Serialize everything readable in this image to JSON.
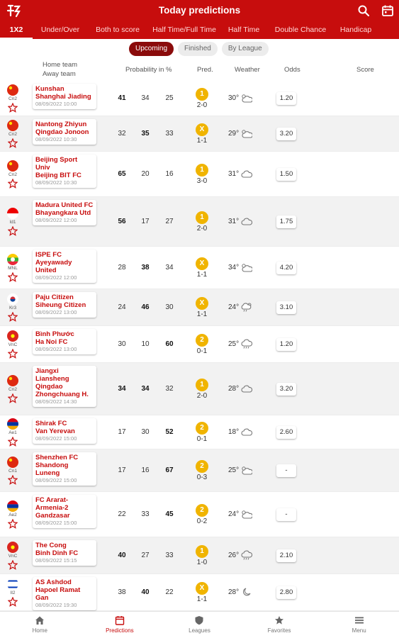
{
  "header": {
    "title": "Today predictions",
    "tabs": [
      "1X2",
      "Under/Over",
      "Both to score",
      "Half Time/Full Time",
      "Half Time",
      "Double Chance",
      "Handicap"
    ]
  },
  "filters": [
    "Upcoming",
    "Finished",
    "By League"
  ],
  "columns": {
    "home_team": "Home team",
    "away_team": "Away team",
    "probability": "Probability in %",
    "pred": "Pred.",
    "weather": "Weather",
    "odds": "Odds",
    "score": "Score"
  },
  "matches": [
    {
      "league": "Cn2",
      "home": "Kunshan",
      "away": "Shanghai Jiading",
      "date": "08/09/2022 10:00",
      "p1": "41",
      "px": "34",
      "p2": "25",
      "pred": "1",
      "pred_score": "2-0",
      "temp": "30°",
      "weather_icon": "cloud-sun-icon",
      "odds": "1.20"
    },
    {
      "league": "Cn2",
      "home": "Nantong Zhiyun",
      "away": "Qingdao Jonoon",
      "date": "08/09/2022 10:30",
      "p1": "32",
      "px": "35",
      "p2": "33",
      "pred": "X",
      "pred_score": "1-1",
      "temp": "29°",
      "weather_icon": "cloud-sun-icon",
      "odds": "3.20"
    },
    {
      "league": "Cn2",
      "home": "Beijing Sport Univ",
      "away": "Beijing BIT FC",
      "date": "08/09/2022 10:30",
      "p1": "65",
      "px": "20",
      "p2": "16",
      "pred": "1",
      "pred_score": "3-0",
      "temp": "31°",
      "weather_icon": "cloud-icon",
      "odds": "1.50"
    },
    {
      "league": "Id1",
      "home": "Madura United FC",
      "away": "Bhayangkara Utd",
      "date": "08/09/2022 12:00",
      "p1": "56",
      "px": "17",
      "p2": "27",
      "pred": "1",
      "pred_score": "2-0",
      "temp": "31°",
      "weather_icon": "cloud-icon",
      "odds": "1.75"
    },
    {
      "league": "MNL",
      "home": "ISPE FC",
      "away": "Ayeyawady United",
      "date": "08/09/2022 12:00",
      "p1": "28",
      "px": "38",
      "p2": "34",
      "pred": "X",
      "pred_score": "1-1",
      "temp": "34°",
      "weather_icon": "cloud-sun-icon",
      "odds": "4.20"
    },
    {
      "league": "Kr3",
      "home": "Paju Citizen",
      "away": "Siheung Citizen",
      "date": "08/09/2022 13:00",
      "p1": "24",
      "px": "46",
      "p2": "30",
      "pred": "X",
      "pred_score": "1-1",
      "temp": "24°",
      "weather_icon": "cloud-rain-sun-icon",
      "odds": "3.10"
    },
    {
      "league": "VnC",
      "home": "Bình Phước",
      "away": "Ha Noi FC",
      "date": "08/09/2022 13:00",
      "p1": "30",
      "px": "10",
      "p2": "60",
      "pred": "2",
      "pred_score": "0-1",
      "temp": "25°",
      "weather_icon": "cloud-rain-icon",
      "odds": "1.20"
    },
    {
      "league": "Cn2",
      "home": "Jiangxi Liansheng",
      "away": "Qingdao Zhongchuang H.",
      "date": "08/09/2022 14:30",
      "p1": "34",
      "px": "34",
      "p2": "32",
      "pred": "1",
      "pred_score": "2-0",
      "temp": "28°",
      "weather_icon": "cloud-icon",
      "odds": "3.20"
    },
    {
      "league": "Ae1",
      "home": "Shirak FC",
      "away": "Van Yerevan",
      "date": "08/09/2022 15:00",
      "p1": "17",
      "px": "30",
      "p2": "52",
      "pred": "2",
      "pred_score": "0-1",
      "temp": "18°",
      "weather_icon": "cloud-icon",
      "odds": "2.60"
    },
    {
      "league": "Cn1",
      "home": "Shenzhen FC",
      "away": "Shandong Luneng",
      "date": "08/09/2022 15:00",
      "p1": "17",
      "px": "16",
      "p2": "67",
      "pred": "2",
      "pred_score": "0-3",
      "temp": "25°",
      "weather_icon": "cloud-sun-icon",
      "odds": "-"
    },
    {
      "league": "Ae2",
      "home": "FC Ararat-Armenia-2",
      "away": "Gandzasar",
      "date": "08/09/2022 15:00",
      "p1": "22",
      "px": "33",
      "p2": "45",
      "pred": "2",
      "pred_score": "0-2",
      "temp": "24°",
      "weather_icon": "cloud-sun-icon",
      "odds": "-"
    },
    {
      "league": "VnC",
      "home": "The Cong",
      "away": "Binh Dinh FC",
      "date": "08/09/2022 15:15",
      "p1": "40",
      "px": "27",
      "p2": "33",
      "pred": "1",
      "pred_score": "1-0",
      "temp": "26°",
      "weather_icon": "cloud-rain-icon",
      "odds": "2.10"
    },
    {
      "league": "Il2",
      "home": "AS Ashdod",
      "away": "Hapoel Ramat Gan",
      "date": "08/09/2022 19:30",
      "p1": "38",
      "px": "40",
      "p2": "22",
      "pred": "X",
      "pred_score": "1-1",
      "temp": "28°",
      "weather_icon": "moon-cloud-icon",
      "odds": "2.80"
    }
  ],
  "nav": [
    "Home",
    "Predictions",
    "Leagues",
    "Favorites",
    "Menu"
  ],
  "colors": {
    "brand": "#c70d0d",
    "predict_badge": "#f0b400",
    "chip_active": "#8a0b0b"
  }
}
